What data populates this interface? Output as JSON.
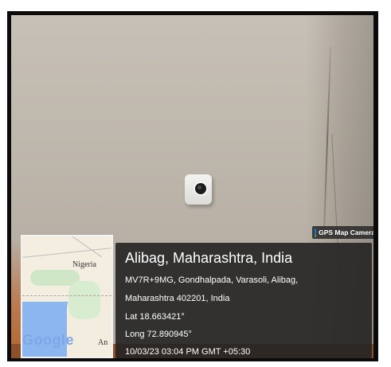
{
  "overlay": {
    "brand_label": "GPS Map Camera",
    "brand_icon": "gps-map-camera-app-icon",
    "location_title": "Alibag, Maharashtra, India",
    "address_line1": "MV7R+9MG, Gondhalpada, Varasoli, Alibag,",
    "address_line2": "Maharashtra 402201, India",
    "latitude": "Lat 18.663421°",
    "longitude": "Long 72.890945°",
    "datetime": "10/03/23 03:04 PM GMT +05:30"
  },
  "map": {
    "label_country": "Nigeria",
    "label_partial": "An",
    "logo": "Google",
    "colors": {
      "land": "#f3ede0",
      "water": "#8bb6ef",
      "vegetation": "#cfe7c7"
    }
  },
  "photo": {
    "subject_icon": "security-camera-icon"
  }
}
